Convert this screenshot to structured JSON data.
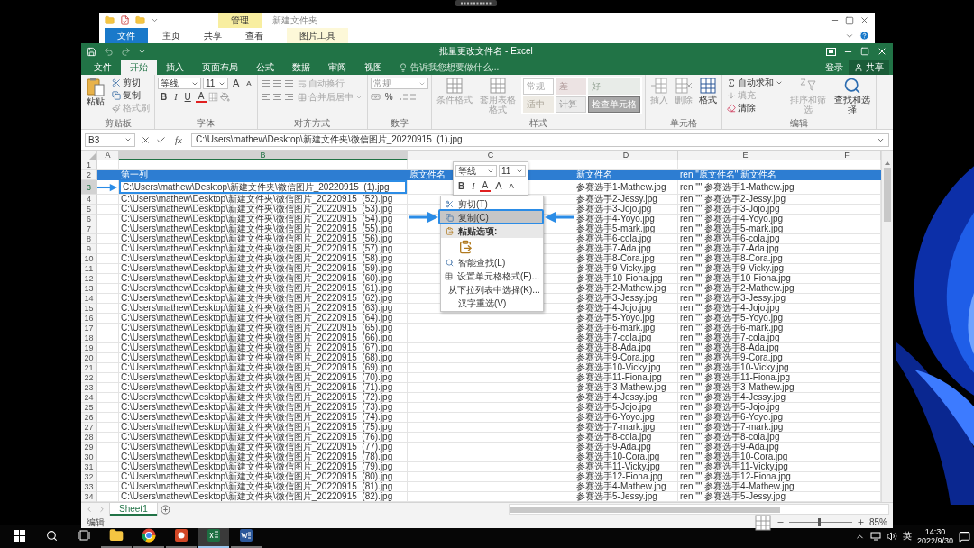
{
  "explorer": {
    "context_tab": "管理",
    "title": "新建文件夹",
    "file_tab": "文件",
    "tabs": [
      "主页",
      "共享",
      "查看"
    ],
    "context_group": "图片工具"
  },
  "excel": {
    "title": "批量更改文件名 - Excel",
    "tabs": [
      {
        "label": "文件",
        "selected": false
      },
      {
        "label": "开始",
        "selected": true
      },
      {
        "label": "插入",
        "selected": false
      },
      {
        "label": "页面布局",
        "selected": false
      },
      {
        "label": "公式",
        "selected": false
      },
      {
        "label": "数据",
        "selected": false
      },
      {
        "label": "审阅",
        "selected": false
      },
      {
        "label": "视图",
        "selected": false
      }
    ],
    "tell_me": "告诉我您想要做什么...",
    "sign_in": "登录",
    "share": "共享",
    "ribbon": {
      "clipboard": {
        "label": "剪贴板",
        "paste": {
          "label": "粘贴",
          "disabled": false
        },
        "cut": {
          "label": "剪切",
          "disabled": false
        },
        "copy": {
          "label": "复制",
          "disabled": false
        },
        "format_painter": {
          "label": "格式刷",
          "disabled": true
        }
      },
      "font": {
        "label": "字体",
        "font_name": "等线",
        "font_size": "11",
        "size_buttons": [
          {
            "label": "A",
            "kind": "grow"
          },
          {
            "label": "A",
            "kind": "shrink"
          }
        ],
        "buttons": [
          {
            "label": "B",
            "kind": "bold"
          },
          {
            "label": "I",
            "kind": "italic"
          },
          {
            "label": "U",
            "kind": "underline"
          },
          {
            "label": "A",
            "kind": "color"
          }
        ]
      },
      "alignment": {
        "label": "对齐方式",
        "wrap": {
          "label": "自动换行",
          "disabled": true
        },
        "merge": {
          "label": "合并后居中",
          "disabled": true
        }
      },
      "number": {
        "label": "数字",
        "format": "常规",
        "percent": "%"
      },
      "styles": {
        "label": "样式",
        "conditional": {
          "label": "条件格式",
          "disabled": true
        },
        "table": {
          "label": "套用表格格式",
          "disabled": true
        },
        "cells": [
          {
            "label": "常规",
            "kind": "normal"
          },
          {
            "label": "差",
            "kind": "bad"
          },
          {
            "label": "好",
            "kind": "good"
          },
          {
            "label": "适中",
            "kind": "neutral"
          },
          {
            "label": "计算",
            "kind": "calc"
          },
          {
            "label": "检查单元格",
            "kind": "check"
          }
        ]
      },
      "cells": {
        "label": "单元格",
        "buttons": [
          {
            "label": "插入",
            "kind": "insert",
            "disabled": true
          },
          {
            "label": "删除",
            "kind": "delete",
            "disabled": true
          },
          {
            "label": "格式",
            "kind": "format",
            "disabled": false
          }
        ]
      },
      "editing": {
        "label": "编辑",
        "autosum": {
          "label": "自动求和",
          "disabled": false
        },
        "fill": {
          "label": "填充",
          "disabled": true
        },
        "clear": {
          "label": "清除",
          "disabled": false
        },
        "sort": {
          "label": "排序和筛选",
          "disabled": true
        },
        "find": {
          "label": "查找和选择",
          "disabled": false
        }
      }
    },
    "name_box": "B3",
    "function_label": "fx",
    "formula": "C:\\Users\\mathew\\Desktop\\新建文件夹\\微信图片_20220915  (1).jpg",
    "columns": [
      {
        "label": "A",
        "selected": false
      },
      {
        "label": "B",
        "selected": true
      },
      {
        "label": "C",
        "selected": false
      },
      {
        "label": "D",
        "selected": false
      },
      {
        "label": "E",
        "selected": false
      },
      {
        "label": "F",
        "selected": false
      }
    ],
    "rows": [
      {
        "number": "1",
        "kind": "blank",
        "selected": false
      },
      {
        "number": "2",
        "kind": "header",
        "selected": false,
        "b": "第一列",
        "c": "原文件名",
        "d": "新文件名",
        "e": "ren \"原文件名\" 新文件名"
      },
      {
        "number": "3",
        "kind": "data",
        "selected": true,
        "b": "C:\\Users\\mathew\\Desktop\\新建文件夹\\微信图片_20220915  (1).jpg",
        "d": "参赛选手1-Mathew.jpg",
        "e": "ren \"\" 参赛选手1-Mathew.jpg"
      },
      {
        "number": "4",
        "kind": "data",
        "selected": false,
        "b": "C:\\Users\\mathew\\Desktop\\新建文件夹\\微信图片_20220915  (52).jpg",
        "d": "参赛选手2-Jessy.jpg",
        "e": "ren \"\" 参赛选手2-Jessy.jpg"
      },
      {
        "number": "5",
        "kind": "data",
        "selected": false,
        "b": "C:\\Users\\mathew\\Desktop\\新建文件夹\\微信图片_20220915  (53).jpg",
        "d": "参赛选手3-Jojo.jpg",
        "e": "ren \"\" 参赛选手3-Jojo.jpg"
      },
      {
        "number": "6",
        "kind": "data",
        "selected": false,
        "b": "C:\\Users\\mathew\\Desktop\\新建文件夹\\微信图片_20220915  (54).jpg",
        "d": "参赛选手4-Yoyo.jpg",
        "e": "ren \"\" 参赛选手4-Yoyo.jpg"
      },
      {
        "number": "7",
        "kind": "data",
        "selected": false,
        "b": "C:\\Users\\mathew\\Desktop\\新建文件夹\\微信图片_20220915  (55).jpg",
        "d": "参赛选手5-mark.jpg",
        "e": "ren \"\" 参赛选手5-mark.jpg"
      },
      {
        "number": "8",
        "kind": "data",
        "selected": false,
        "b": "C:\\Users\\mathew\\Desktop\\新建文件夹\\微信图片_20220915  (56).jpg",
        "d": "参赛选手6-cola.jpg",
        "e": "ren \"\" 参赛选手6-cola.jpg"
      },
      {
        "number": "9",
        "kind": "data",
        "selected": false,
        "b": "C:\\Users\\mathew\\Desktop\\新建文件夹\\微信图片_20220915  (57).jpg",
        "d": "参赛选手7-Ada.jpg",
        "e": "ren \"\" 参赛选手7-Ada.jpg"
      },
      {
        "number": "10",
        "kind": "data",
        "selected": false,
        "b": "C:\\Users\\mathew\\Desktop\\新建文件夹\\微信图片_20220915  (58).jpg",
        "d": "参赛选手8-Cora.jpg",
        "e": "ren \"\" 参赛选手8-Cora.jpg"
      },
      {
        "number": "11",
        "kind": "data",
        "selected": false,
        "b": "C:\\Users\\mathew\\Desktop\\新建文件夹\\微信图片_20220915  (59).jpg",
        "d": "参赛选手9-Vicky.jpg",
        "e": "ren \"\" 参赛选手9-Vicky.jpg"
      },
      {
        "number": "12",
        "kind": "data",
        "selected": false,
        "b": "C:\\Users\\mathew\\Desktop\\新建文件夹\\微信图片_20220915  (60).jpg",
        "d": "参赛选手10-Fiona.jpg",
        "e": "ren \"\" 参赛选手10-Fiona.jpg"
      },
      {
        "number": "13",
        "kind": "data",
        "selected": false,
        "b": "C:\\Users\\mathew\\Desktop\\新建文件夹\\微信图片_20220915  (61).jpg",
        "d": "参赛选手2-Mathew.jpg",
        "e": "ren \"\" 参赛选手2-Mathew.jpg"
      },
      {
        "number": "14",
        "kind": "data",
        "selected": false,
        "b": "C:\\Users\\mathew\\Desktop\\新建文件夹\\微信图片_20220915  (62).jpg",
        "d": "参赛选手3-Jessy.jpg",
        "e": "ren \"\" 参赛选手3-Jessy.jpg"
      },
      {
        "number": "15",
        "kind": "data",
        "selected": false,
        "b": "C:\\Users\\mathew\\Desktop\\新建文件夹\\微信图片_20220915  (63).jpg",
        "d": "参赛选手4-Jojo.jpg",
        "e": "ren \"\" 参赛选手4-Jojo.jpg"
      },
      {
        "number": "16",
        "kind": "data",
        "selected": false,
        "b": "C:\\Users\\mathew\\Desktop\\新建文件夹\\微信图片_20220915  (64).jpg",
        "d": "参赛选手5-Yoyo.jpg",
        "e": "ren \"\" 参赛选手5-Yoyo.jpg"
      },
      {
        "number": "17",
        "kind": "data",
        "selected": false,
        "b": "C:\\Users\\mathew\\Desktop\\新建文件夹\\微信图片_20220915  (65).jpg",
        "d": "参赛选手6-mark.jpg",
        "e": "ren \"\" 参赛选手6-mark.jpg"
      },
      {
        "number": "18",
        "kind": "data",
        "selected": false,
        "b": "C:\\Users\\mathew\\Desktop\\新建文件夹\\微信图片_20220915  (66).jpg",
        "d": "参赛选手7-cola.jpg",
        "e": "ren \"\" 参赛选手7-cola.jpg"
      },
      {
        "number": "19",
        "kind": "data",
        "selected": false,
        "b": "C:\\Users\\mathew\\Desktop\\新建文件夹\\微信图片_20220915  (67).jpg",
        "d": "参赛选手8-Ada.jpg",
        "e": "ren \"\" 参赛选手8-Ada.jpg"
      },
      {
        "number": "20",
        "kind": "data",
        "selected": false,
        "b": "C:\\Users\\mathew\\Desktop\\新建文件夹\\微信图片_20220915  (68).jpg",
        "d": "参赛选手9-Cora.jpg",
        "e": "ren \"\" 参赛选手9-Cora.jpg"
      },
      {
        "number": "21",
        "kind": "data",
        "selected": false,
        "b": "C:\\Users\\mathew\\Desktop\\新建文件夹\\微信图片_20220915  (69).jpg",
        "d": "参赛选手10-Vicky.jpg",
        "e": "ren \"\" 参赛选手10-Vicky.jpg"
      },
      {
        "number": "22",
        "kind": "data",
        "selected": false,
        "b": "C:\\Users\\mathew\\Desktop\\新建文件夹\\微信图片_20220915  (70).jpg",
        "d": "参赛选手11-Fiona.jpg",
        "e": "ren \"\" 参赛选手11-Fiona.jpg"
      },
      {
        "number": "23",
        "kind": "data",
        "selected": false,
        "b": "C:\\Users\\mathew\\Desktop\\新建文件夹\\微信图片_20220915  (71).jpg",
        "d": "参赛选手3-Mathew.jpg",
        "e": "ren \"\" 参赛选手3-Mathew.jpg"
      },
      {
        "number": "24",
        "kind": "data",
        "selected": false,
        "b": "C:\\Users\\mathew\\Desktop\\新建文件夹\\微信图片_20220915  (72).jpg",
        "d": "参赛选手4-Jessy.jpg",
        "e": "ren \"\" 参赛选手4-Jessy.jpg"
      },
      {
        "number": "25",
        "kind": "data",
        "selected": false,
        "b": "C:\\Users\\mathew\\Desktop\\新建文件夹\\微信图片_20220915  (73).jpg",
        "d": "参赛选手5-Jojo.jpg",
        "e": "ren \"\" 参赛选手5-Jojo.jpg"
      },
      {
        "number": "26",
        "kind": "data",
        "selected": false,
        "b": "C:\\Users\\mathew\\Desktop\\新建文件夹\\微信图片_20220915  (74).jpg",
        "d": "参赛选手6-Yoyo.jpg",
        "e": "ren \"\" 参赛选手6-Yoyo.jpg"
      },
      {
        "number": "27",
        "kind": "data",
        "selected": false,
        "b": "C:\\Users\\mathew\\Desktop\\新建文件夹\\微信图片_20220915  (75).jpg",
        "d": "参赛选手7-mark.jpg",
        "e": "ren \"\" 参赛选手7-mark.jpg"
      },
      {
        "number": "28",
        "kind": "data",
        "selected": false,
        "b": "C:\\Users\\mathew\\Desktop\\新建文件夹\\微信图片_20220915  (76).jpg",
        "d": "参赛选手8-cola.jpg",
        "e": "ren \"\" 参赛选手8-cola.jpg"
      },
      {
        "number": "29",
        "kind": "data",
        "selected": false,
        "b": "C:\\Users\\mathew\\Desktop\\新建文件夹\\微信图片_20220915  (77).jpg",
        "d": "参赛选手9-Ada.jpg",
        "e": "ren \"\" 参赛选手9-Ada.jpg"
      },
      {
        "number": "30",
        "kind": "data",
        "selected": false,
        "b": "C:\\Users\\mathew\\Desktop\\新建文件夹\\微信图片_20220915  (78).jpg",
        "d": "参赛选手10-Cora.jpg",
        "e": "ren \"\" 参赛选手10-Cora.jpg"
      },
      {
        "number": "31",
        "kind": "data",
        "selected": false,
        "b": "C:\\Users\\mathew\\Desktop\\新建文件夹\\微信图片_20220915  (79).jpg",
        "d": "参赛选手11-Vicky.jpg",
        "e": "ren \"\" 参赛选手11-Vicky.jpg"
      },
      {
        "number": "32",
        "kind": "data",
        "selected": false,
        "b": "C:\\Users\\mathew\\Desktop\\新建文件夹\\微信图片_20220915  (80).jpg",
        "d": "参赛选手12-Fiona.jpg",
        "e": "ren \"\" 参赛选手12-Fiona.jpg"
      },
      {
        "number": "33",
        "kind": "data",
        "selected": false,
        "b": "C:\\Users\\mathew\\Desktop\\新建文件夹\\微信图片_20220915  (81).jpg",
        "d": "参赛选手4-Mathew.jpg",
        "e": "ren \"\" 参赛选手4-Mathew.jpg"
      },
      {
        "number": "34",
        "kind": "data",
        "selected": false,
        "b": "C:\\Users\\mathew\\Desktop\\新建文件夹\\微信图片_20220915  (82).jpg",
        "d": "参赛选手5-Jessy.jpg",
        "e": "ren \"\" 参赛选手5-Jessy.jpg"
      }
    ],
    "mini_toolbar": {
      "font_name": "等线",
      "font_size": "11",
      "buttons": [
        {
          "label": "B",
          "kind": "bold"
        },
        {
          "label": "I",
          "kind": "italic"
        },
        {
          "label": "A",
          "kind": "color"
        },
        {
          "label": "A",
          "kind": "grow"
        },
        {
          "label": "A",
          "kind": "shrink"
        }
      ]
    },
    "context_menu": [
      {
        "kind": "cut",
        "label": "剪切(T)",
        "selected": false
      },
      {
        "kind": "copy",
        "label": "复制(C)",
        "selected": true
      },
      {
        "kind": "heading",
        "label": "粘贴选项:",
        "selected": false
      },
      {
        "kind": "paste",
        "selected": false
      },
      {
        "kind": "lookup",
        "label": "智能查找(L)",
        "selected": false
      },
      {
        "kind": "format",
        "label": "设置单元格格式(F)...",
        "selected": false
      },
      {
        "kind": "plain",
        "label": "从下拉列表中选择(K)...",
        "selected": false
      },
      {
        "kind": "plain",
        "label": "汉字重选(V)",
        "selected": false
      }
    ],
    "sheets": [
      {
        "label": "Sheet1",
        "selected": true
      }
    ],
    "status": "编辑",
    "zoom": {
      "reading": "85%",
      "level": 0.47
    }
  },
  "taskbar": {
    "apps": [
      {
        "kind": "files",
        "selected": false
      },
      {
        "kind": "browser",
        "selected": false
      },
      {
        "kind": "slides",
        "selected": false
      },
      {
        "kind": "sheets",
        "selected": true
      },
      {
        "kind": "docs",
        "selected": false
      }
    ],
    "input_method": "英",
    "time": "14:30",
    "date": "2022/9/30"
  }
}
